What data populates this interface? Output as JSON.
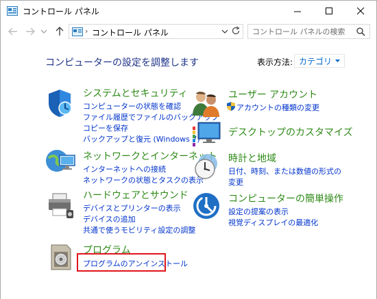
{
  "window": {
    "title": "コントロール パネル"
  },
  "address": {
    "path": "コントロール パネル",
    "separator": "›"
  },
  "search": {
    "placeholder": "コントロール パネルの検索"
  },
  "header": {
    "heading": "コンピューターの設定を調整します",
    "view_by_label": "表示方法:",
    "view_by_value": "カテゴリ"
  },
  "categories": {
    "system": {
      "title": "システムとセキュリティ",
      "links": [
        "コンピューターの状態を確認",
        "ファイル履歴でファイルのバックアップ",
        "コピーを保存",
        "バックアップと復元 (Windows 7)"
      ]
    },
    "network": {
      "title": "ネットワークとインターネット",
      "links": [
        "インターネットへの接続",
        "ネットワークの状態とタスクの表示"
      ]
    },
    "hardware": {
      "title": "ハードウェアとサウンド",
      "links": [
        "デバイスとプリンターの表示",
        "デバイスの追加",
        "共通で使うモビリティ設定の調整"
      ]
    },
    "programs": {
      "title": "プログラム",
      "links": [
        "プログラムのアンインストール"
      ]
    },
    "accounts": {
      "title": "ユーザー アカウント",
      "links": [
        "アカウントの種類の変更"
      ]
    },
    "appearance": {
      "title": "デスクトップのカスタマイズ",
      "links": []
    },
    "clock": {
      "title": "時計と地域",
      "links": [
        "日付、時刻、または数値の形式の",
        "変更"
      ]
    },
    "ease": {
      "title": "コンピューターの簡単操作",
      "links": [
        "設定の提案の表示",
        "視覚ディスプレイの最適化"
      ]
    }
  },
  "colors": {
    "category_title": "#2e8a17",
    "link": "#0033cc",
    "heading": "#1e3287",
    "highlight": "#e0141d"
  }
}
